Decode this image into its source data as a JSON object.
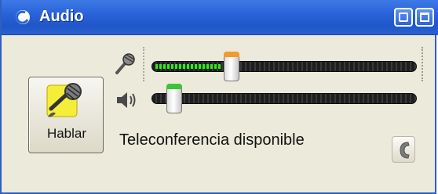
{
  "window": {
    "title": "Audio",
    "app_icon": "app-logo-icon",
    "minimize_icon": "minimize-icon",
    "restore_icon": "restore-icon"
  },
  "talk_button": {
    "label": "Hablar",
    "icon": "microphone-icon"
  },
  "microphone": {
    "icon": "microphone-level-icon",
    "level_fraction": 0.25,
    "slider_fraction": 0.29
  },
  "speaker": {
    "icon": "speaker-volume-icon",
    "slider_fraction": 0.06
  },
  "status": {
    "text": "Teleconferencia disponible"
  },
  "phone_button": {
    "icon": "phone-icon"
  },
  "colors": {
    "titlebar": "#2a63d9",
    "panel": "#ebeadb",
    "level_green": "#35e81e",
    "mic_thumb_accent": "#f29a2a",
    "volume_thumb_accent": "#3cc436"
  }
}
